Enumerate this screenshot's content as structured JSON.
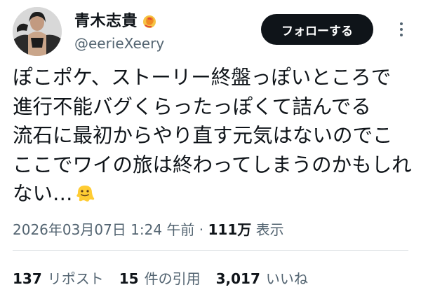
{
  "author": {
    "display_name": "青木志貴",
    "handle": "@eerieXeery",
    "avatar": "avatar-photo",
    "badge_icon": "badge-icon"
  },
  "actions": {
    "follow_label": "フォローする",
    "more_icon": "more-dots-icon"
  },
  "tweet": {
    "lines": [
      "ぽこポケ、ストーリー終盤っぽいところで",
      "進行不能バグくらったっぽくて詰んでる",
      "流石に最初からやり直す元気はないのでこ",
      "ここでワイの旅は終わってしまうのかもしれ",
      "ない…"
    ],
    "trailing_emoji": "melting-face-emoji"
  },
  "meta": {
    "timestamp": "2026年03月07日 1:24 午前",
    "separator": " · ",
    "views_count": "111万",
    "views_label": " 表示"
  },
  "stats": [
    {
      "count": "137",
      "label": "リポスト"
    },
    {
      "count": "15",
      "label": "件の引用"
    },
    {
      "count": "3,017",
      "label": "いいね"
    }
  ],
  "colors": {
    "text_primary": "#0f1419",
    "text_secondary": "#536471",
    "follow_bg": "#0f1419",
    "follow_text": "#ffffff",
    "divider": "#dfe3e6"
  }
}
